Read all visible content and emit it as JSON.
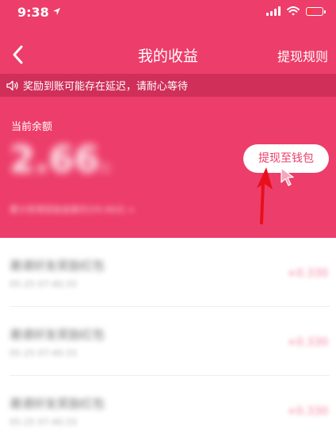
{
  "status_bar": {
    "time": "9:38"
  },
  "nav": {
    "title": "我的收益",
    "rules_link": "提现规则"
  },
  "notice": {
    "text": "奖励到账可能存在延迟，请耐心等待"
  },
  "balance": {
    "label": "当前余额",
    "amount": "2.66",
    "unit": "元",
    "subtext": "累计获得奖励金额共计6.66元 >",
    "withdraw_button": "提现至钱包"
  },
  "records": [
    {
      "title": "邀请好友奖励红包",
      "time": "05-25 07:40:33",
      "amount": "+0.330"
    },
    {
      "title": "邀请好友奖励红包",
      "time": "05-25 07:40:33",
      "amount": "+0.330"
    },
    {
      "title": "邀请好友奖励红包",
      "time": "05-25 07:40:33",
      "amount": "+0.330"
    }
  ],
  "colors": {
    "brand": "#ed3d6a",
    "notice_bg": "#cf2f59",
    "annotation_arrow": "#e8101c"
  }
}
